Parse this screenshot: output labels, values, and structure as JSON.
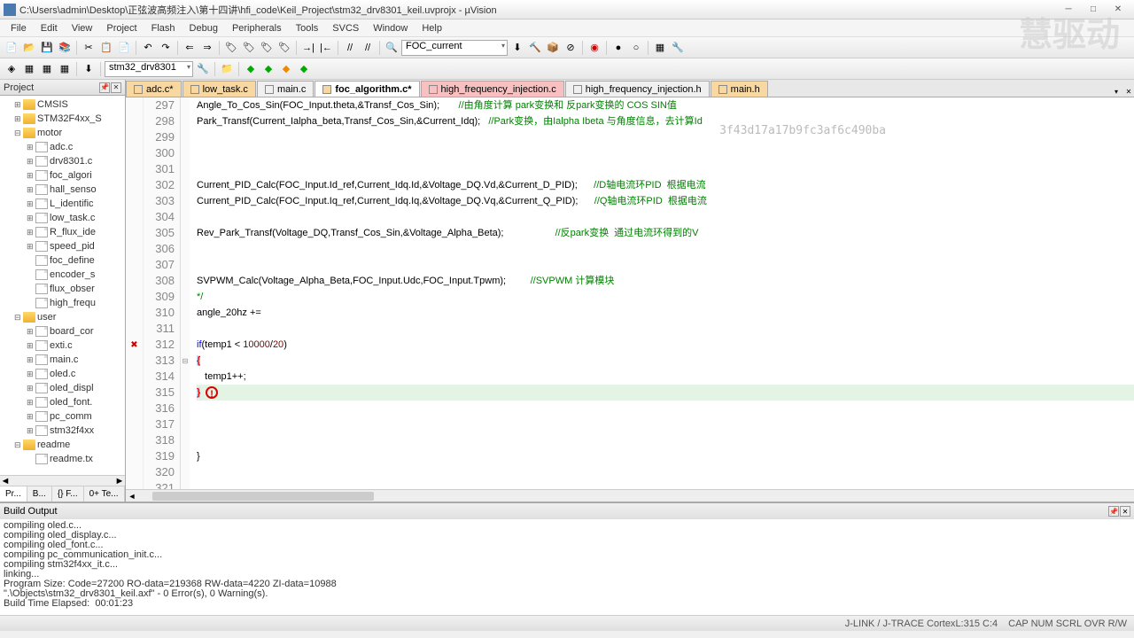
{
  "title": "C:\\Users\\admin\\Desktop\\正弦波高频注入\\第十四讲\\hfi_code\\Keil_Project\\stm32_drv8301_keil.uvprojx - µVision",
  "menus": [
    "File",
    "Edit",
    "View",
    "Project",
    "Flash",
    "Debug",
    "Peripherals",
    "Tools",
    "SVCS",
    "Window",
    "Help"
  ],
  "toolbar_combo1": "FOC_current",
  "toolbar_combo2": "stm32_drv8301",
  "project": {
    "header": "Project",
    "tree": [
      {
        "l": "CMSIS",
        "t": "folder",
        "i": 1,
        "exp": "+"
      },
      {
        "l": "STM32F4xx_S",
        "t": "folder",
        "i": 1,
        "exp": "+"
      },
      {
        "l": "motor",
        "t": "folder",
        "i": 1,
        "exp": "-"
      },
      {
        "l": "adc.c",
        "t": "file",
        "i": 2,
        "exp": "+"
      },
      {
        "l": "drv8301.c",
        "t": "file",
        "i": 2,
        "exp": "+"
      },
      {
        "l": "foc_algori",
        "t": "file",
        "i": 2,
        "exp": "+"
      },
      {
        "l": "hall_senso",
        "t": "file",
        "i": 2,
        "exp": "+"
      },
      {
        "l": "L_identific",
        "t": "file",
        "i": 2,
        "exp": "+"
      },
      {
        "l": "low_task.c",
        "t": "file",
        "i": 2,
        "exp": "+"
      },
      {
        "l": "R_flux_ide",
        "t": "file",
        "i": 2,
        "exp": "+"
      },
      {
        "l": "speed_pid",
        "t": "file",
        "i": 2,
        "exp": "+"
      },
      {
        "l": "foc_define",
        "t": "file",
        "i": 2,
        "exp": ""
      },
      {
        "l": "encoder_s",
        "t": "file",
        "i": 2,
        "exp": ""
      },
      {
        "l": "flux_obser",
        "t": "file",
        "i": 2,
        "exp": ""
      },
      {
        "l": "high_frequ",
        "t": "file",
        "i": 2,
        "exp": ""
      },
      {
        "l": "user",
        "t": "folder",
        "i": 1,
        "exp": "-"
      },
      {
        "l": "board_cor",
        "t": "file",
        "i": 2,
        "exp": "+"
      },
      {
        "l": "exti.c",
        "t": "file",
        "i": 2,
        "exp": "+"
      },
      {
        "l": "main.c",
        "t": "file",
        "i": 2,
        "exp": "+"
      },
      {
        "l": "oled.c",
        "t": "file",
        "i": 2,
        "exp": "+"
      },
      {
        "l": "oled_displ",
        "t": "file",
        "i": 2,
        "exp": "+"
      },
      {
        "l": "oled_font.",
        "t": "file",
        "i": 2,
        "exp": "+"
      },
      {
        "l": "pc_comm",
        "t": "file",
        "i": 2,
        "exp": "+"
      },
      {
        "l": "stm32f4xx",
        "t": "file",
        "i": 2,
        "exp": "+"
      },
      {
        "l": "readme",
        "t": "folder",
        "i": 1,
        "exp": "-"
      },
      {
        "l": "readme.tx",
        "t": "file",
        "i": 2,
        "exp": ""
      }
    ],
    "tabs": [
      "Pr...",
      "B...",
      "{} F...",
      "0+ Te..."
    ]
  },
  "file_tabs": [
    {
      "name": "adc.c*",
      "color": "#f8d8a0"
    },
    {
      "name": "low_task.c",
      "color": "#f8d8a0"
    },
    {
      "name": "main.c",
      "color": "#f0f0f0"
    },
    {
      "name": "foc_algorithm.c*",
      "color": "#f8d8a0",
      "active": true
    },
    {
      "name": "high_frequency_injection.c",
      "color": "#f8c0c0"
    },
    {
      "name": "high_frequency_injection.h",
      "color": "#f0f0f0"
    },
    {
      "name": "main.h",
      "color": "#f8d8a0"
    }
  ],
  "code": {
    "start": 297,
    "lines": [
      {
        "n": 297,
        "t": "Angle_To_Cos_Sin(FOC_Input.theta,&Transf_Cos_Sin);       ",
        "c": "//由角度计算 park变换和 反park变换的 COS SIN值"
      },
      {
        "n": 298,
        "t": "Park_Transf(Current_Ialpha_beta,Transf_Cos_Sin,&Current_Idq);   ",
        "c": "//Park变换，由Ialpha Ibeta 与角度信息，去计算Id"
      },
      {
        "n": 299,
        "t": ""
      },
      {
        "n": 300,
        "t": ""
      },
      {
        "n": 301,
        "t": ""
      },
      {
        "n": 302,
        "t": "Current_PID_Calc(FOC_Input.Id_ref,Current_Idq.Id,&Voltage_DQ.Vd,&Current_D_PID);      ",
        "c": "//D轴电流环PID  根据电流"
      },
      {
        "n": 303,
        "t": "Current_PID_Calc(FOC_Input.Iq_ref,Current_Idq.Iq,&Voltage_DQ.Vq,&Current_Q_PID);      ",
        "c": "//Q轴电流环PID  根据电流"
      },
      {
        "n": 304,
        "t": ""
      },
      {
        "n": 305,
        "t": "Rev_Park_Transf(Voltage_DQ,Transf_Cos_Sin,&Voltage_Alpha_Beta);                   ",
        "c": "//反park变换  通过电流环得到的V"
      },
      {
        "n": 306,
        "t": ""
      },
      {
        "n": 307,
        "t": ""
      },
      {
        "n": 308,
        "t": "SVPWM_Calc(Voltage_Alpha_Beta,FOC_Input.Udc,FOC_Input.Tpwm);         ",
        "c": "//SVPWM 计算模块"
      },
      {
        "n": 309,
        "t": "*/",
        "cm": true
      },
      {
        "n": 310,
        "t": "angle_20hz +="
      },
      {
        "n": 311,
        "t": ""
      },
      {
        "n": 312,
        "t": "if(temp1 < 10000/20)",
        "mark": "x",
        "kw": true
      },
      {
        "n": 313,
        "t": "{",
        "br": true,
        "fold": "-"
      },
      {
        "n": 314,
        "t": "   temp1++;"
      },
      {
        "n": 315,
        "t": "}",
        "br": true,
        "hl": true,
        "err": true
      },
      {
        "n": 316,
        "t": ""
      },
      {
        "n": 317,
        "t": ""
      },
      {
        "n": 318,
        "t": ""
      },
      {
        "n": 319,
        "t": "}",
        "close": true
      },
      {
        "n": 320,
        "t": ""
      },
      {
        "n": 321,
        "t": ""
      }
    ]
  },
  "build": {
    "header": "Build Output",
    "lines": [
      "compiling oled.c...",
      "compiling oled_display.c...",
      "compiling oled_font.c...",
      "compiling pc_communication_init.c...",
      "compiling stm32f4xx_it.c...",
      "linking...",
      "Program Size: Code=27200 RO-data=219368 RW-data=4220 ZI-data=10988",
      "\".\\Objects\\stm32_drv8301_keil.axf\" - 0 Error(s), 0 Warning(s).",
      "Build Time Elapsed:  00:01:23"
    ]
  },
  "status": {
    "center": "J-LINK / J-TRACE Cortex",
    "cursor": "L:315 C:4",
    "caps": "CAP NUM SCRL OVR R/W"
  },
  "watermark": "慧驱动",
  "hash": "3f43d17a17b9fc3af6c490ba"
}
